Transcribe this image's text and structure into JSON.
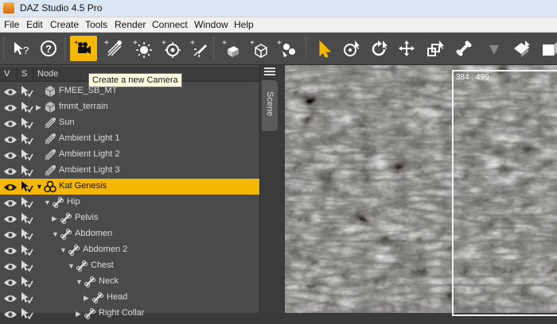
{
  "window": {
    "title": "DAZ Studio 4.5 Pro"
  },
  "menu": {
    "items": [
      "File",
      "Edit",
      "Create",
      "Tools",
      "Render",
      "Connect",
      "Window",
      "Help"
    ]
  },
  "toolbar": {
    "active_tool": "new-camera",
    "tooltip": "Create a new Camera",
    "tools": [
      "what-is-this",
      "help",
      "new-camera",
      "new-distant-light",
      "new-spot-light",
      "new-point-light",
      "new-linear-point-light",
      "new-primitive",
      "new-null",
      "new-node-instance",
      "node-selection",
      "rotate-view",
      "translate",
      "universal",
      "scale",
      "joint-editor",
      "geometry-editor",
      "surface-selection",
      "render-settings"
    ]
  },
  "scene": {
    "tab_label": "Scene",
    "columns": {
      "v": "V",
      "s": "S",
      "node": "Node"
    },
    "rows": [
      {
        "label": "FMEE_SB_MT",
        "depth": 0,
        "expander": "",
        "icon": "cube-icon",
        "selected": false
      },
      {
        "label": "fmmt_terrain",
        "depth": 0,
        "expander": "collapsed",
        "icon": "cube-icon",
        "selected": false
      },
      {
        "label": "Sun",
        "depth": 0,
        "expander": "",
        "icon": "distant-light-icon",
        "selected": false
      },
      {
        "label": "Ambient Light 1",
        "depth": 0,
        "expander": "",
        "icon": "distant-light-icon",
        "selected": false
      },
      {
        "label": "Ambient Light 2",
        "depth": 0,
        "expander": "",
        "icon": "distant-light-icon",
        "selected": false
      },
      {
        "label": "Ambient Light 3",
        "depth": 0,
        "expander": "",
        "icon": "distant-light-icon",
        "selected": false
      },
      {
        "label": "Kat Genesis",
        "depth": 0,
        "expander": "expanded",
        "icon": "figure-icon",
        "selected": true
      },
      {
        "label": "Hip",
        "depth": 1,
        "expander": "expanded",
        "icon": "bone-icon",
        "selected": false
      },
      {
        "label": "Pelvis",
        "depth": 2,
        "expander": "collapsed",
        "icon": "bone-icon",
        "selected": false
      },
      {
        "label": "Abdomen",
        "depth": 2,
        "expander": "expanded",
        "icon": "bone-icon",
        "selected": false
      },
      {
        "label": "Abdomen 2",
        "depth": 3,
        "expander": "expanded",
        "icon": "bone-icon",
        "selected": false
      },
      {
        "label": "Chest",
        "depth": 4,
        "expander": "expanded",
        "icon": "bone-icon",
        "selected": false
      },
      {
        "label": "Neck",
        "depth": 5,
        "expander": "expanded",
        "icon": "bone-icon",
        "selected": false
      },
      {
        "label": "Head",
        "depth": 6,
        "expander": "collapsed",
        "icon": "bone-icon",
        "selected": false
      },
      {
        "label": "Right Collar",
        "depth": 5,
        "expander": "collapsed",
        "icon": "bone-icon",
        "selected": false
      }
    ]
  },
  "viewport": {
    "coordinates": "384 : 499"
  },
  "colors": {
    "accent": "#f4b800",
    "panel": "#4a4a4a",
    "toolbar": "#4a4a4a"
  }
}
